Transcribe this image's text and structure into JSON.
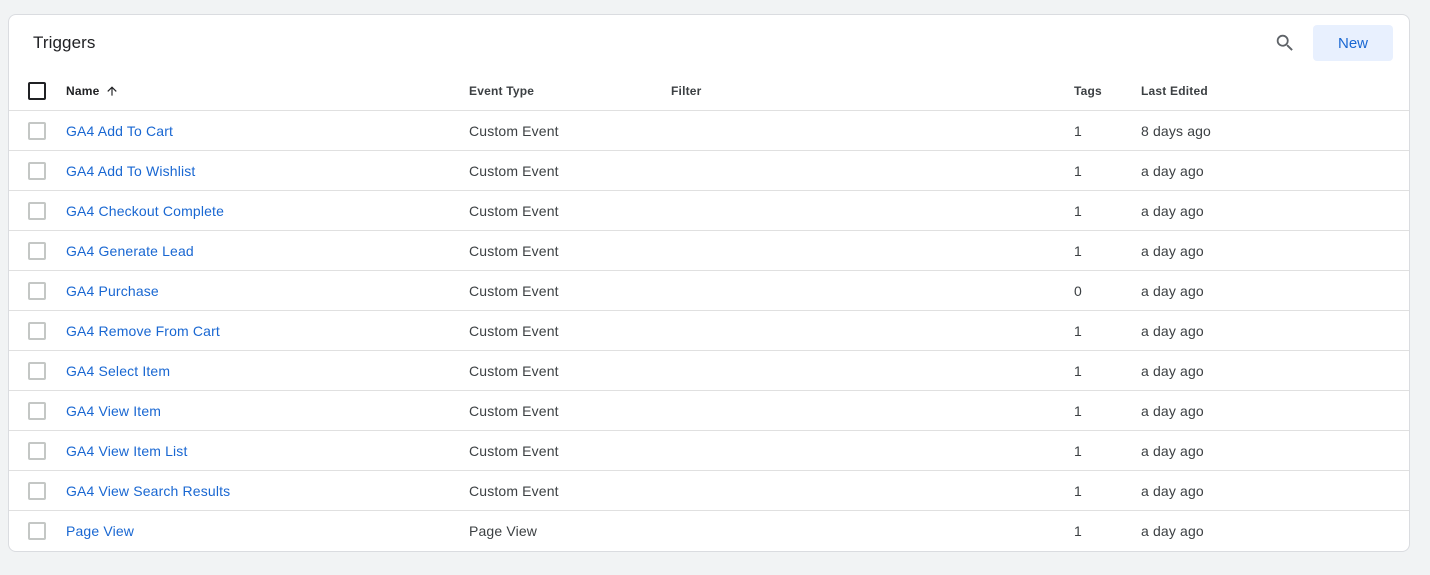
{
  "header": {
    "title": "Triggers",
    "new_label": "New"
  },
  "icons": {
    "search": "search-icon",
    "sort": "arrow-up-icon"
  },
  "colors": {
    "link": "#1967d2",
    "new_button_bg": "#e8f0fe",
    "page_bg": "#f1f3f4"
  },
  "table": {
    "columns": {
      "name": "Name",
      "event_type": "Event Type",
      "filter": "Filter",
      "tags": "Tags",
      "last_edited": "Last Edited"
    },
    "sort": {
      "column": "name",
      "direction": "ascending"
    },
    "rows": [
      {
        "name": "GA4 Add To Cart",
        "event_type": "Custom Event",
        "filter": "",
        "tags": "1",
        "last_edited": "8 days ago"
      },
      {
        "name": "GA4 Add To Wishlist",
        "event_type": "Custom Event",
        "filter": "",
        "tags": "1",
        "last_edited": "a day ago"
      },
      {
        "name": "GA4 Checkout Complete",
        "event_type": "Custom Event",
        "filter": "",
        "tags": "1",
        "last_edited": "a day ago"
      },
      {
        "name": "GA4 Generate Lead",
        "event_type": "Custom Event",
        "filter": "",
        "tags": "1",
        "last_edited": "a day ago"
      },
      {
        "name": "GA4 Purchase",
        "event_type": "Custom Event",
        "filter": "",
        "tags": "0",
        "last_edited": "a day ago"
      },
      {
        "name": "GA4 Remove From Cart",
        "event_type": "Custom Event",
        "filter": "",
        "tags": "1",
        "last_edited": "a day ago"
      },
      {
        "name": "GA4 Select Item",
        "event_type": "Custom Event",
        "filter": "",
        "tags": "1",
        "last_edited": "a day ago"
      },
      {
        "name": "GA4 View Item",
        "event_type": "Custom Event",
        "filter": "",
        "tags": "1",
        "last_edited": "a day ago"
      },
      {
        "name": "GA4 View Item List",
        "event_type": "Custom Event",
        "filter": "",
        "tags": "1",
        "last_edited": "a day ago"
      },
      {
        "name": "GA4 View Search Results",
        "event_type": "Custom Event",
        "filter": "",
        "tags": "1",
        "last_edited": "a day ago"
      },
      {
        "name": "Page View",
        "event_type": "Page View",
        "filter": "",
        "tags": "1",
        "last_edited": "a day ago"
      }
    ]
  }
}
